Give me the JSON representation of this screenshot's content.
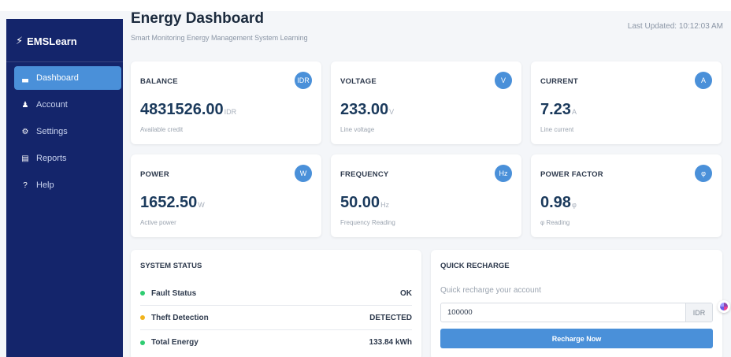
{
  "app": {
    "brand": "EMSLearn",
    "brand_icon": "bolt-icon"
  },
  "sidebar": {
    "items": [
      {
        "label": "Dashboard",
        "icon": "chart-bar-icon",
        "glyph": "▃",
        "active": true
      },
      {
        "label": "Account",
        "icon": "user-icon",
        "glyph": "♟",
        "active": false
      },
      {
        "label": "Settings",
        "icon": "gear-icon",
        "glyph": "⚙",
        "active": false
      },
      {
        "label": "Reports",
        "icon": "report-icon",
        "glyph": "▤",
        "active": false
      },
      {
        "label": "Help",
        "icon": "question-icon",
        "glyph": "?",
        "active": false
      }
    ]
  },
  "header": {
    "title": "Energy Dashboard",
    "subtitle": "Smart Monitoring Energy Management System Learning",
    "last_updated": "Last Updated: 10:12:03 AM"
  },
  "metrics": [
    {
      "label": "BALANCE",
      "badge": "IDR",
      "value": "4831526.00",
      "unit": "IDR",
      "desc": "Available credit"
    },
    {
      "label": "VOLTAGE",
      "badge": "V",
      "value": "233.00",
      "unit": "V",
      "desc": "Line voltage"
    },
    {
      "label": "CURRENT",
      "badge": "A",
      "value": "7.23",
      "unit": "A",
      "desc": "Line current"
    },
    {
      "label": "POWER",
      "badge": "W",
      "value": "1652.50",
      "unit": "W",
      "desc": "Active power"
    },
    {
      "label": "FREQUENCY",
      "badge": "Hz",
      "value": "50.00",
      "unit": "Hz",
      "desc": "Frequency Reading"
    },
    {
      "label": "POWER FACTOR",
      "badge": "φ",
      "value": "0.98",
      "unit": "φ",
      "desc": "φ Reading"
    }
  ],
  "system_status": {
    "title": "SYSTEM STATUS",
    "rows": [
      {
        "label": "Fault Status",
        "value": "OK",
        "color": "#2ecc71"
      },
      {
        "label": "Theft Detection",
        "value": "DETECTED",
        "color": "#f1b31c"
      },
      {
        "label": "Total Energy",
        "value": "133.84 kWh",
        "color": "#2ecc71"
      }
    ]
  },
  "recharge": {
    "title": "QUICK RECHARGE",
    "subtitle": "Quick recharge your account",
    "input_value": "100000",
    "currency": "IDR",
    "button_label": "Recharge Now"
  },
  "colors": {
    "sidebar_bg": "#14256b",
    "accent": "#4a90d9",
    "value_text": "#1b3a5c"
  }
}
